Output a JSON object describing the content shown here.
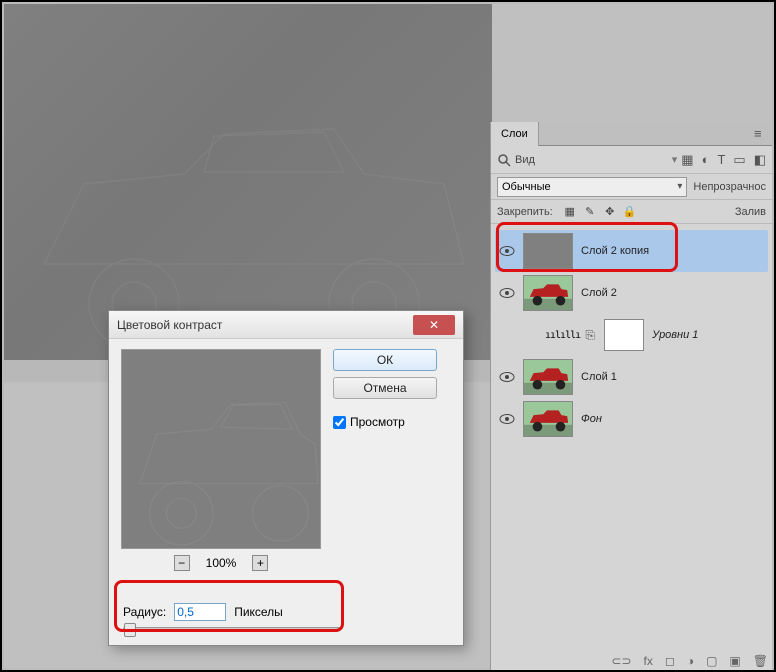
{
  "layers_panel": {
    "tab_label": "Слои",
    "filter_type": "Вид",
    "blend_mode": "Обычные",
    "opacity_label": "Непрозрачнос",
    "lock_label": "Закрепить:",
    "fill_label": "Залив",
    "layers": [
      {
        "name": "Слой 2 копия",
        "selected": true,
        "thumb": "gray"
      },
      {
        "name": "Слой 2",
        "selected": false,
        "thumb": "truck"
      },
      {
        "name": "Уровни 1",
        "selected": false,
        "thumb": "levels"
      },
      {
        "name": "Слой 1",
        "selected": false,
        "thumb": "truck"
      },
      {
        "name": "Фон",
        "selected": false,
        "thumb": "truck"
      }
    ]
  },
  "dialog": {
    "title": "Цветовой контраст",
    "ok_label": "ОК",
    "cancel_label": "Отмена",
    "preview_label": "Просмотр",
    "zoom_value": "100%",
    "radius_label": "Радиус:",
    "radius_value": "0,5",
    "unit_label": "Пикселы"
  },
  "icons": {
    "minus": "−",
    "plus": "+",
    "close": "✕",
    "pixel": "▦",
    "adjust": "◐",
    "type": "T",
    "shape": "▭",
    "smart": "◧",
    "brush": "✎",
    "move": "✥",
    "lock": "🔒",
    "link": "⊂⊃",
    "fx": "fx",
    "mask": "◻",
    "newlayer": "▣",
    "trash": "🗑",
    "folder": "▢",
    "adj2": "◑"
  }
}
